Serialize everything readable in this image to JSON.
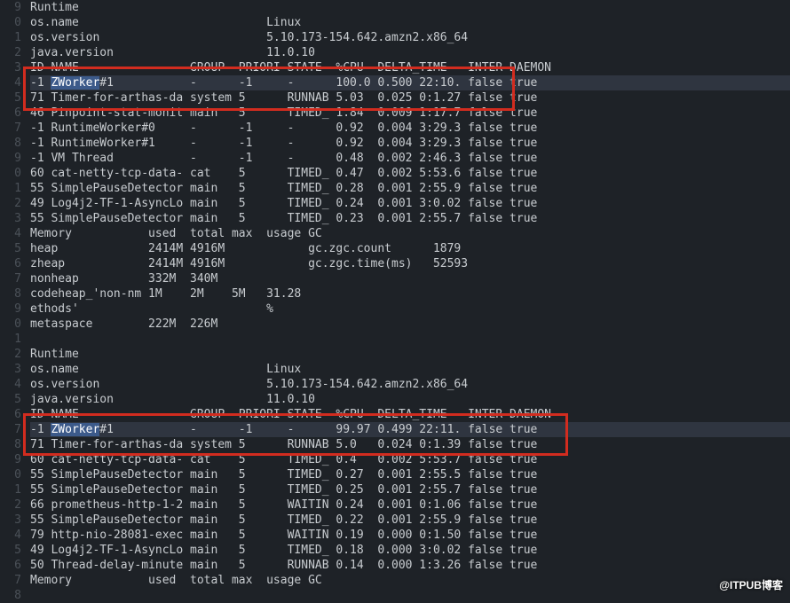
{
  "gutter_start_tens": 0,
  "lines": [
    "9",
    "0",
    "1",
    "2",
    "3",
    "4",
    "5",
    "6",
    "7",
    "8",
    "9",
    "0",
    "1",
    "2",
    "3",
    "4",
    "5",
    "6",
    "7",
    "8",
    "9",
    "0",
    "1",
    "2",
    "3",
    "4",
    "5",
    "6",
    "7",
    "8",
    "9",
    "0",
    "1",
    "2",
    "3",
    "4",
    "5",
    "6",
    "7",
    "8"
  ],
  "block1": {
    "runtime_header": "Runtime",
    "os_name_lbl": "os.name",
    "os_name_val": "Linux",
    "os_version_lbl": "os.version",
    "os_version_val": "5.10.173-154.642.amzn2.x86_64",
    "java_version_lbl": "java.version",
    "java_version_val": "11.0.10",
    "thread_header": {
      "id": "ID",
      "name": "NAME",
      "group": "GROUP",
      "priori": "PRIORI",
      "state": "STATE",
      "cpu": "%CPU",
      "delta": "DELTA_",
      "time": "TIME",
      "inter": "INTER",
      "daemon": "DAEMON"
    },
    "threads": [
      {
        "id": "-1",
        "name": "ZWorker#1",
        "group": "-",
        "priori": "-1",
        "state": "-",
        "cpu": "100.0",
        "delta": "0.500",
        "time": "22:10.",
        "inter": "false",
        "daemon": "true",
        "highlight": true,
        "sel": "ZWorker"
      },
      {
        "id": "71",
        "name": "Timer-for-arthas-da",
        "group": "system",
        "priori": "5",
        "state": "RUNNAB",
        "cpu": "5.03",
        "delta": "0.025",
        "time": "0:1.27",
        "inter": "false",
        "daemon": "true",
        "strike": true
      },
      {
        "id": "46",
        "name": "Pinpoint-stat-monit",
        "group": "main",
        "priori": "5",
        "state": "TIMED_",
        "cpu": "1.84",
        "delta": "0.009",
        "time": "1:17.7",
        "inter": "false",
        "daemon": "true"
      },
      {
        "id": "-1",
        "name": "RuntimeWorker#0",
        "group": "-",
        "priori": "-1",
        "state": "-",
        "cpu": "0.92",
        "delta": "0.004",
        "time": "3:29.3",
        "inter": "false",
        "daemon": "true"
      },
      {
        "id": "-1",
        "name": "RuntimeWorker#1",
        "group": "-",
        "priori": "-1",
        "state": "-",
        "cpu": "0.92",
        "delta": "0.004",
        "time": "3:29.3",
        "inter": "false",
        "daemon": "true"
      },
      {
        "id": "-1",
        "name": "VM Thread",
        "group": "-",
        "priori": "-1",
        "state": "-",
        "cpu": "0.48",
        "delta": "0.002",
        "time": "2:46.3",
        "inter": "false",
        "daemon": "true"
      },
      {
        "id": "60",
        "name": "cat-netty-tcp-data-",
        "group": "cat",
        "priori": "5",
        "state": "TIMED_",
        "cpu": "0.47",
        "delta": "0.002",
        "time": "5:53.6",
        "inter": "false",
        "daemon": "true"
      },
      {
        "id": "55",
        "name": "SimplePauseDetector",
        "group": "main",
        "priori": "5",
        "state": "TIMED_",
        "cpu": "0.28",
        "delta": "0.001",
        "time": "2:55.9",
        "inter": "false",
        "daemon": "true"
      },
      {
        "id": "49",
        "name": "Log4j2-TF-1-AsyncLo",
        "group": "main",
        "priori": "5",
        "state": "TIMED_",
        "cpu": "0.24",
        "delta": "0.001",
        "time": "3:0.02",
        "inter": "false",
        "daemon": "true"
      },
      {
        "id": "55",
        "name": "SimplePauseDetector",
        "group": "main",
        "priori": "5",
        "state": "TIMED_",
        "cpu": "0.23",
        "delta": "0.001",
        "time": "2:55.7",
        "inter": "false",
        "daemon": "true"
      }
    ],
    "memory_header": {
      "label": "Memory",
      "used": "used",
      "total": "total",
      "max": "max",
      "usage": "usage",
      "gc": "GC"
    },
    "memory_rows": [
      {
        "name": "heap",
        "used": "2414M",
        "total": "4916M",
        "max": "",
        "usage": "",
        "gclabel": "gc.zgc.count",
        "gcval": "1879"
      },
      {
        "name": "zheap",
        "used": "2414M",
        "total": "4916M",
        "max": "",
        "usage": "",
        "gclabel": "gc.zgc.time(ms)",
        "gcval": "52593"
      },
      {
        "name": "nonheap",
        "used": "332M",
        "total": "340M",
        "max": "",
        "usage": ""
      },
      {
        "name": "codeheap_'non-nm",
        "used": "1M",
        "total": "2M",
        "max": "5M",
        "usage": "31.28"
      },
      {
        "name": "ethods'",
        "used": "",
        "total": "",
        "max": "",
        "usage": "%"
      },
      {
        "name": "metaspace",
        "used": "222M",
        "total": "226M",
        "max": "",
        "usage": ""
      }
    ]
  },
  "block2": {
    "runtime_header": "Runtime",
    "os_name_lbl": "os.name",
    "os_name_val": "Linux",
    "os_version_lbl": "os.version",
    "os_version_val": "5.10.173-154.642.amzn2.x86_64",
    "java_version_lbl": "java.version",
    "java_version_val": "11.0.10",
    "thread_header": {
      "id": "ID",
      "name": "NAME",
      "group": "GROUP",
      "priori": "PRIORI",
      "state": "STATE",
      "cpu": "%CPU",
      "delta": "DELTA_",
      "time": "TIME",
      "inter": "INTER",
      "daemon": "DAEMON"
    },
    "threads": [
      {
        "id": "-1",
        "name": "ZWorker#1",
        "group": "-",
        "priori": "-1",
        "state": "-",
        "cpu": "99.97",
        "delta": "0.499",
        "time": "22:11.",
        "inter": "false",
        "daemon": "true",
        "highlight": true,
        "sel": "ZWorker"
      },
      {
        "id": "71",
        "name": "Timer-for-arthas-da",
        "group": "system",
        "priori": "5",
        "state": "RUNNAB",
        "cpu": "5.0",
        "delta": "0.024",
        "time": "0:1.39",
        "inter": "false",
        "daemon": "true",
        "strike": true
      },
      {
        "id": "60",
        "name": "cat-netty-tcp-data-",
        "group": "cat",
        "priori": "5",
        "state": "TIMED_",
        "cpu": "0.4",
        "delta": "0.002",
        "time": "5:53.7",
        "inter": "false",
        "daemon": "true"
      },
      {
        "id": "55",
        "name": "SimplePauseDetector",
        "group": "main",
        "priori": "5",
        "state": "TIMED_",
        "cpu": "0.27",
        "delta": "0.001",
        "time": "2:55.5",
        "inter": "false",
        "daemon": "true"
      },
      {
        "id": "55",
        "name": "SimplePauseDetector",
        "group": "main",
        "priori": "5",
        "state": "TIMED_",
        "cpu": "0.25",
        "delta": "0.001",
        "time": "2:55.7",
        "inter": "false",
        "daemon": "true"
      },
      {
        "id": "66",
        "name": "prometheus-http-1-2",
        "group": "main",
        "priori": "5",
        "state": "WAITIN",
        "cpu": "0.24",
        "delta": "0.001",
        "time": "0:1.06",
        "inter": "false",
        "daemon": "true"
      },
      {
        "id": "55",
        "name": "SimplePauseDetector",
        "group": "main",
        "priori": "5",
        "state": "TIMED_",
        "cpu": "0.22",
        "delta": "0.001",
        "time": "2:55.9",
        "inter": "false",
        "daemon": "true"
      },
      {
        "id": "79",
        "name": "http-nio-28081-exec",
        "group": "main",
        "priori": "5",
        "state": "WAITIN",
        "cpu": "0.19",
        "delta": "0.000",
        "time": "0:1.50",
        "inter": "false",
        "daemon": "true"
      },
      {
        "id": "49",
        "name": "Log4j2-TF-1-AsyncLo",
        "group": "main",
        "priori": "5",
        "state": "TIMED_",
        "cpu": "0.18",
        "delta": "0.000",
        "time": "3:0.02",
        "inter": "false",
        "daemon": "true"
      },
      {
        "id": "50",
        "name": "Thread-delay-minute",
        "group": "main",
        "priori": "5",
        "state": "RUNNAB",
        "cpu": "0.14",
        "delta": "0.000",
        "time": "1:3.26",
        "inter": "false",
        "daemon": "true"
      }
    ],
    "memory_header": {
      "label": "Memory",
      "used": "used",
      "total": "total",
      "max": "max",
      "usage": "usage",
      "gc": "GC"
    }
  },
  "watermark": "@ITPUB博客"
}
